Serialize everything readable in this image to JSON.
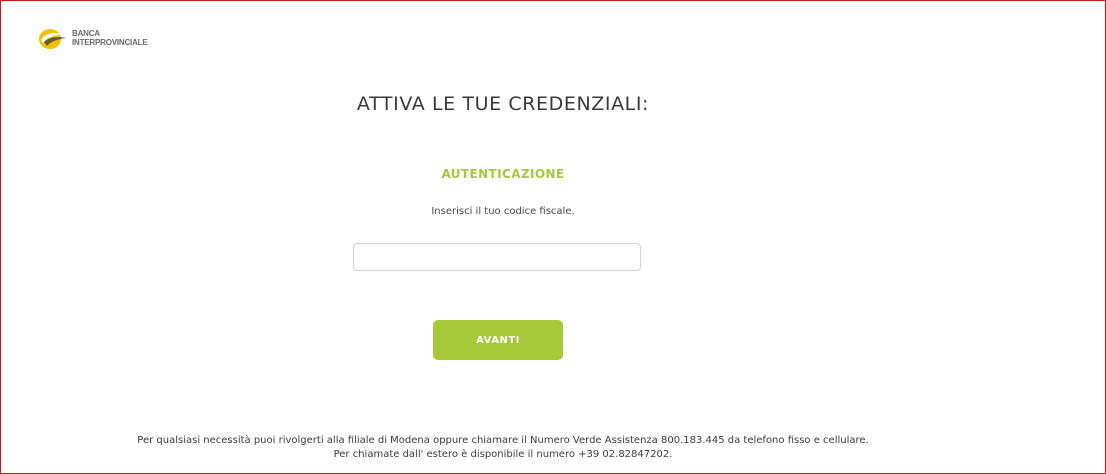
{
  "brand": {
    "line1": "BANCA",
    "line2": "INTERPROVINCIALE",
    "logo_icon": "bank-logo-icon"
  },
  "page": {
    "title": "ATTIVA LE TUE CREDENZIALI:"
  },
  "authentication": {
    "heading": "AUTENTICAZIONE",
    "instruction": "Inserisci il tuo codice fiscale.",
    "fiscal_code_value": "",
    "fiscal_code_placeholder": ""
  },
  "actions": {
    "next_label": "AVANTI"
  },
  "footer": {
    "line1": "Per qualsiasi necessità puoi rivolgerti alla filiale di Modena oppure chiamare il Numero Verde Assistenza 800.183.445 da telefono fisso e cellulare.",
    "line2": "Per chiamate dall' estero è disponibile il numero +39 02.82847202."
  },
  "colors": {
    "accent_green": "#a6c93a",
    "frame_border": "#c5171c",
    "text_dark": "#3a3a3a"
  }
}
